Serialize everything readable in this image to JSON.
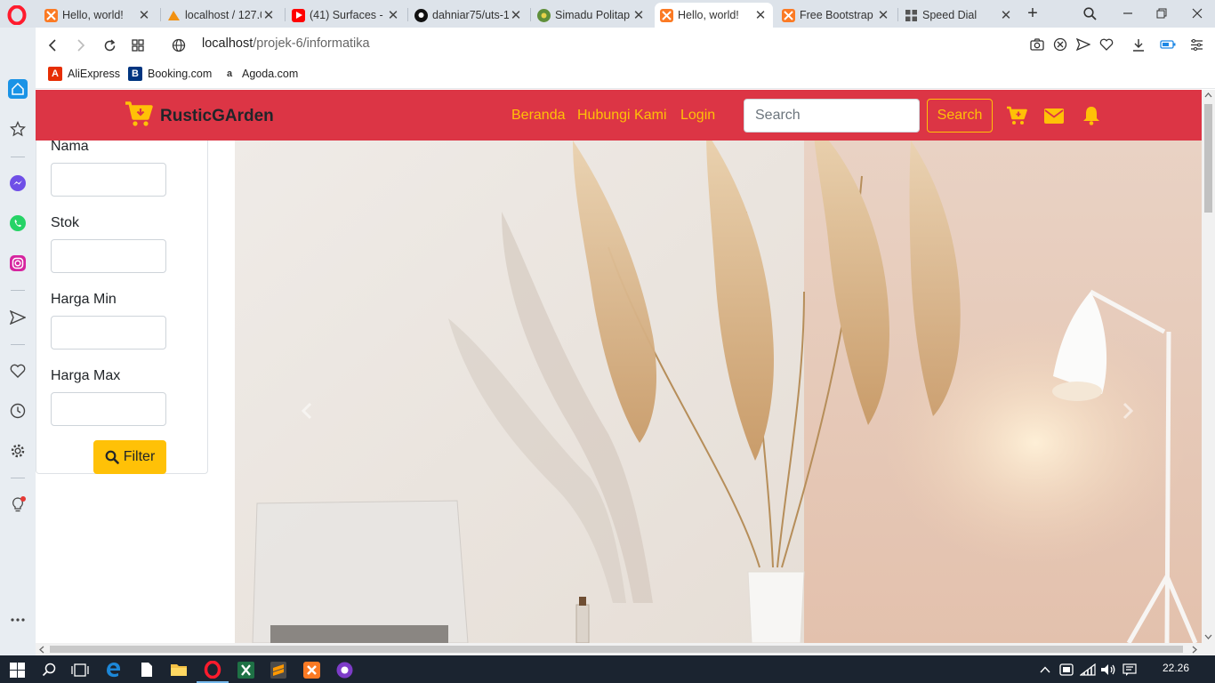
{
  "browser": {
    "tabs": [
      {
        "title": "Hello, world!",
        "active": false
      },
      {
        "title": "localhost / 127.0",
        "active": false
      },
      {
        "title": "(41) Surfaces - S",
        "active": false
      },
      {
        "title": "dahniar75/uts-1",
        "active": false
      },
      {
        "title": "Simadu Politap",
        "active": false
      },
      {
        "title": "Hello, world!",
        "active": true
      },
      {
        "title": "Free Bootstrap",
        "active": false
      },
      {
        "title": "Speed Dial",
        "active": false
      }
    ],
    "url_host": "localhost",
    "url_path": "/projek-6/informatika",
    "bookmarks": [
      "AliExpress",
      "Booking.com",
      "Agoda.com"
    ]
  },
  "site": {
    "brand": "RusticGArden",
    "nav": [
      "Beranda",
      "Hubungi Kami",
      "Login"
    ],
    "search": {
      "placeholder": "Search",
      "button": "Search"
    },
    "colors": {
      "primary": "#dc3545",
      "accent": "#ffc107"
    }
  },
  "filter": {
    "fields": [
      "Nama",
      "Stok",
      "Harga Min",
      "Harga Max"
    ],
    "button": "Filter"
  },
  "taskbar": {
    "clock": "22.26"
  }
}
